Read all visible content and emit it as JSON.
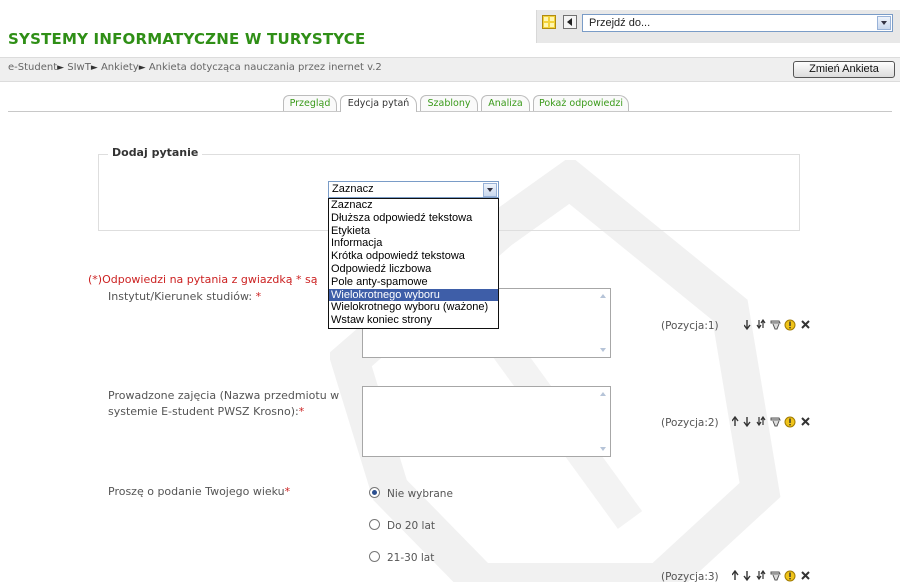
{
  "site_title": "SYSTEMY INFORMATYCZNE W TURYSTYCE",
  "jump_menu": {
    "selected": "Przejdź do..."
  },
  "breadcrumb": {
    "items": [
      "e-Student",
      "SIwT",
      "Ankiety",
      "Ankieta dotycząca nauczania przez inernet v.2"
    ],
    "separator": "►"
  },
  "change_button": "Zmień Ankieta",
  "tabs": [
    {
      "label": "Przegląd",
      "active": false
    },
    {
      "label": "Edycja pytań",
      "active": true
    },
    {
      "label": "Szablony",
      "active": false
    },
    {
      "label": "Analiza",
      "active": false
    },
    {
      "label": "Pokaż odpowiedzi",
      "active": false
    }
  ],
  "add_question": {
    "legend": "Dodaj pytanie",
    "selected": "Zaznacz",
    "options": [
      "Zaznacz",
      "Dłuższa odpowiedź tekstowa",
      "Etykieta",
      "Informacja",
      "Krótka odpowiedź tekstowa",
      "Odpowiedź liczbowa",
      "Pole anty-spamowe",
      "Wielokrotnego wyboru",
      "Wielokrotnego wyboru (ważone)",
      "Wstaw koniec strony"
    ],
    "highlighted": "Wielokrotnego wyboru"
  },
  "required_notice": "(*)Odpowiedzi na pytania z gwiazdką * są",
  "questions": [
    {
      "label": "Instytut/Kierunek studiów:",
      "star": "*",
      "position": "(Pozycja:1)"
    },
    {
      "label_line1": "Prowadzone zajęcia (Nazwa przedmiotu w",
      "label_line2": "systemie E-student PWSZ Krosno):",
      "star": "*",
      "position": "(Pozycja:2)"
    },
    {
      "label": "Proszę o podanie Twojego wieku",
      "star": "*",
      "position": "(Pozycja:3)",
      "options": [
        "Nie wybrane",
        "Do 20 lat",
        "21-30 lat"
      ],
      "selected": "Nie wybrane"
    }
  ],
  "colors": {
    "title_green": "#2f8f16",
    "required_red": "#cc2222",
    "selection_blue": "#3e5ea8"
  },
  "icons": [
    "move-up-icon",
    "move-down-icon",
    "move-to-icon",
    "edit-icon",
    "required-toggle-icon",
    "delete-icon"
  ]
}
